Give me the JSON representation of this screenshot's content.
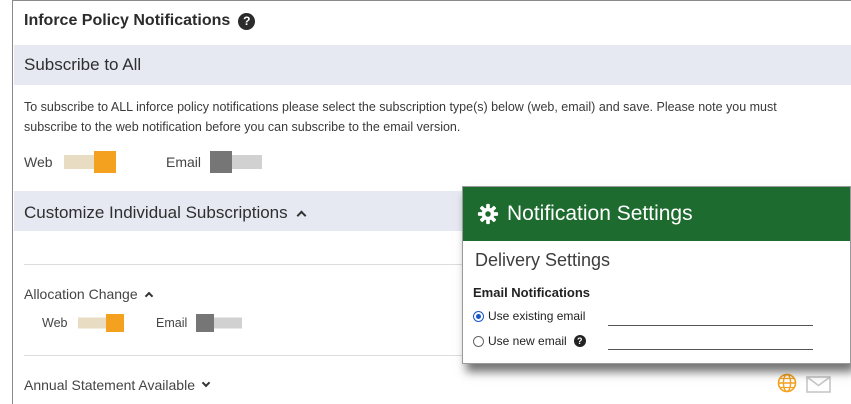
{
  "header": {
    "title": "Inforce Policy Notifications",
    "help_glyph": "?"
  },
  "subscribe_all": {
    "heading": "Subscribe to All",
    "description": "To subscribe to ALL inforce policy notifications please select the subscription type(s) below (web, email) and save. Please note you must subscribe to the web notification before you can subscribe to the email version.",
    "web_label": "Web",
    "email_label": "Email",
    "web_on": true,
    "email_on": false
  },
  "customize": {
    "heading": "Customize Individual Subscriptions",
    "items": [
      {
        "label": "Allocation Change",
        "expanded": true,
        "web_label": "Web",
        "email_label": "Email",
        "web_on": true,
        "email_on": false
      },
      {
        "label": "Annual Statement Available",
        "expanded": false
      }
    ]
  },
  "panel": {
    "title": "Notification Settings",
    "subtitle": "Delivery Settings",
    "section": "Email Notifications",
    "option_existing": "Use existing email",
    "option_new": "Use new email",
    "selected": "existing",
    "help_glyph": "?"
  },
  "colors": {
    "accent_orange": "#f4a11f",
    "panel_green": "#1e6b2f",
    "band": "#e6e9f2"
  },
  "icons": [
    "help-icon",
    "gear-icon",
    "globe-icon",
    "mail-icon",
    "chevron-up-icon",
    "chevron-down-icon"
  ]
}
